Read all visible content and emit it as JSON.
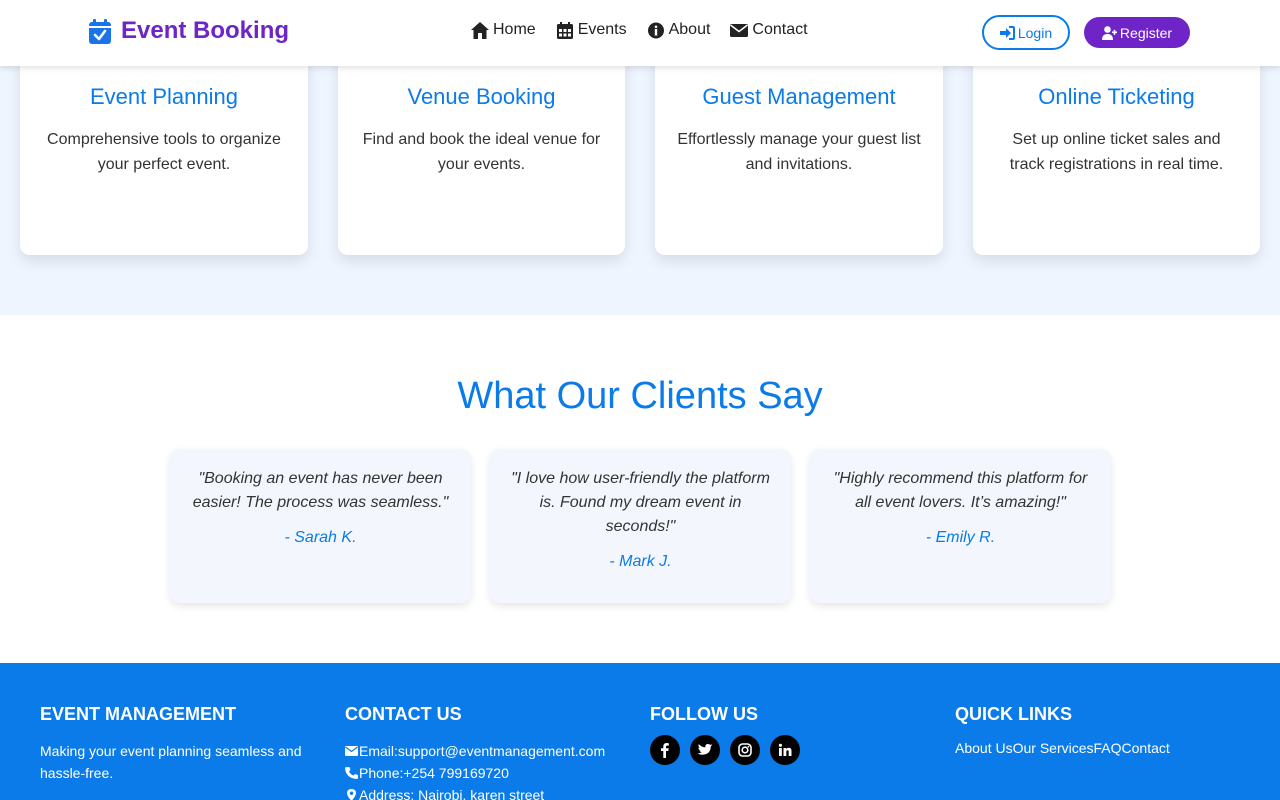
{
  "header": {
    "brand": "Event Booking",
    "nav": [
      {
        "label": "Home",
        "icon": "home-icon"
      },
      {
        "label": "Events",
        "icon": "calendar-icon"
      },
      {
        "label": "About",
        "icon": "info-icon"
      },
      {
        "label": "Contact",
        "icon": "envelope-icon"
      }
    ],
    "login_label": "Login",
    "register_label": "Register"
  },
  "services": [
    {
      "title": "Event Planning",
      "desc": "Comprehensive tools to organize your perfect event."
    },
    {
      "title": "Venue Booking",
      "desc": "Find and book the ideal venue for your events."
    },
    {
      "title": "Guest Management",
      "desc": "Effortlessly manage your guest list and invitations."
    },
    {
      "title": "Online Ticketing",
      "desc": "Set up online ticket sales and track registrations in real time."
    }
  ],
  "testimonials": {
    "title": "What Our Clients Say",
    "items": [
      {
        "quote": "\"Booking an event has never been easier! The process was seamless.\"",
        "author": "- Sarah K."
      },
      {
        "quote": "\"I love how user-friendly the platform is. Found my dream event in seconds!\"",
        "author": "- Mark J."
      },
      {
        "quote": "\"Highly recommend this platform for all event lovers. It’s amazing!\"",
        "author": "- Emily R."
      }
    ]
  },
  "footer": {
    "about": {
      "heading": "Event Management",
      "text": "Making your event planning seamless and hassle-free."
    },
    "contact": {
      "heading": "Contact Us",
      "email": "Email:support@eventmanagement.com",
      "phone": "Phone:+254 799169720",
      "address": "Address: Nairobi, karen street"
    },
    "follow": {
      "heading": "Follow Us",
      "icons": [
        "facebook-icon",
        "twitter-icon",
        "instagram-icon",
        "linkedin-icon"
      ]
    },
    "quick_links": {
      "heading": "Quick Links",
      "links": [
        "About Us",
        "Our Services",
        "FAQ",
        "Contact"
      ]
    }
  },
  "colors": {
    "primary": "#0a7be8",
    "brand": "#6f24c8",
    "section_bg": "#eef5ff",
    "card_bg": "#f3f7fd"
  }
}
